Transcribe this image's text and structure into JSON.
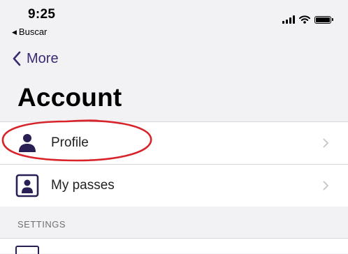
{
  "status_bar": {
    "time": "9:25",
    "back_app_label": "Buscar",
    "icons": [
      "signal-icon",
      "wifi-icon",
      "battery-icon"
    ]
  },
  "nav": {
    "back_label": "More"
  },
  "page": {
    "title": "Account"
  },
  "account_items": [
    {
      "label": "Profile",
      "icon": "person-icon"
    },
    {
      "label": "My passes",
      "icon": "pass-card-icon"
    }
  ],
  "settings": {
    "header": "SETTINGS"
  },
  "colors": {
    "accent": "#3b2a72",
    "icon": "#2a1f54",
    "annotation": "#d8232a",
    "background": "#f2f2f4"
  }
}
